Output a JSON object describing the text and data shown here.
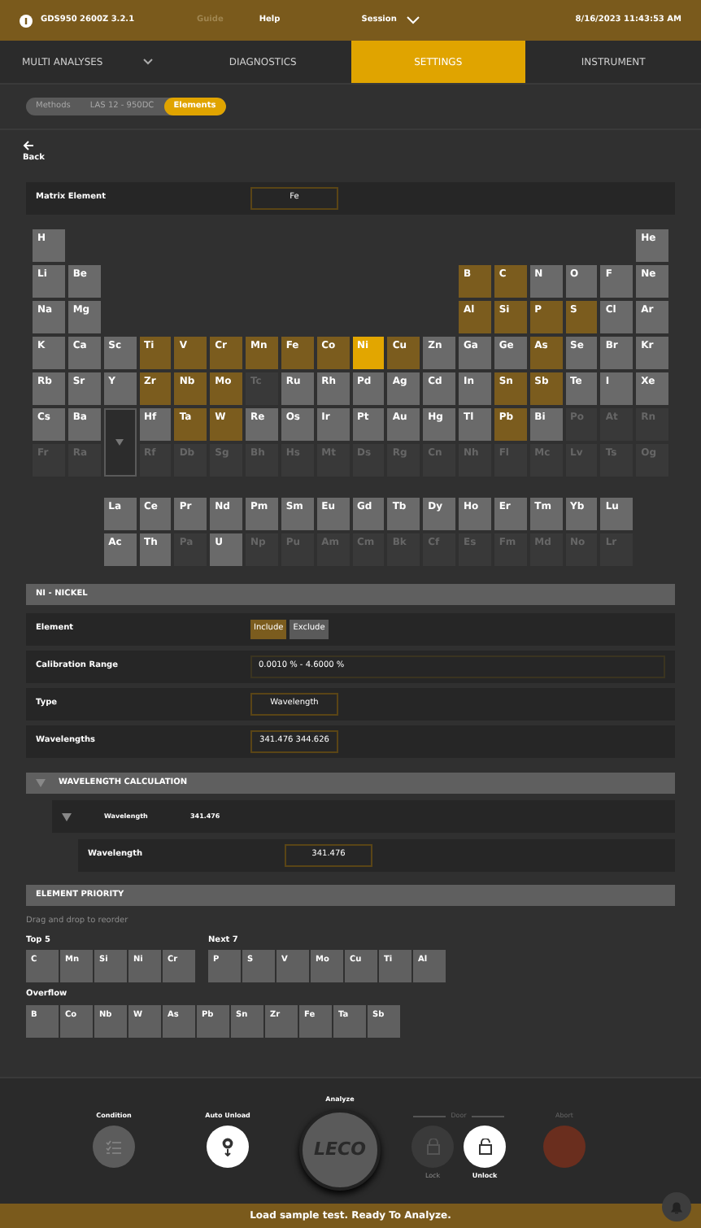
{
  "top_bar": {
    "title": "GDS950 2600Z 3.2.1",
    "links": [
      {
        "label": "Guide",
        "disabled": true
      },
      {
        "label": "Help",
        "disabled": false
      }
    ],
    "session": "Session",
    "datetime": "8/16/2023 11:43:53 AM"
  },
  "tabs": [
    {
      "label": "MULTI ANALYSES",
      "selected": false,
      "dropdown": true
    },
    {
      "label": "DIAGNOSTICS",
      "selected": false,
      "dropdown": false
    },
    {
      "label": "SETTINGS",
      "selected": true,
      "dropdown": false
    },
    {
      "label": "INSTRUMENT",
      "selected": false,
      "dropdown": false
    }
  ],
  "breadcrumb": [
    {
      "label": "Methods",
      "selected": false
    },
    {
      "label": "LAS 12 - 950DC",
      "selected": false
    },
    {
      "label": "Elements",
      "selected": true
    }
  ],
  "back": "Back",
  "matrix": {
    "label": "Matrix Element",
    "value": "Fe"
  },
  "periodic_table": {
    "rows": [
      [
        {
          "s": "H",
          "included": false,
          "selected": false,
          "available": true
        },
        null,
        null,
        null,
        null,
        null,
        null,
        null,
        null,
        null,
        null,
        null,
        null,
        null,
        null,
        null,
        null,
        {
          "s": "He",
          "included": false,
          "selected": false,
          "available": true
        }
      ],
      [
        {
          "s": "Li",
          "included": false,
          "selected": false,
          "available": true
        },
        {
          "s": "Be",
          "included": false,
          "selected": false,
          "available": true
        },
        null,
        null,
        null,
        null,
        null,
        null,
        null,
        null,
        null,
        null,
        {
          "s": "B",
          "included": true,
          "selected": false,
          "available": true
        },
        {
          "s": "C",
          "included": true,
          "selected": false,
          "available": true
        },
        {
          "s": "N",
          "included": false,
          "selected": false,
          "available": true
        },
        {
          "s": "O",
          "included": false,
          "selected": false,
          "available": true
        },
        {
          "s": "F",
          "included": false,
          "selected": false,
          "available": true
        },
        {
          "s": "Ne",
          "included": false,
          "selected": false,
          "available": true
        }
      ],
      [
        {
          "s": "Na",
          "included": false,
          "selected": false,
          "available": true
        },
        {
          "s": "Mg",
          "included": false,
          "selected": false,
          "available": true
        },
        null,
        null,
        null,
        null,
        null,
        null,
        null,
        null,
        null,
        null,
        {
          "s": "Al",
          "included": true,
          "selected": false,
          "available": true
        },
        {
          "s": "Si",
          "included": true,
          "selected": false,
          "available": true
        },
        {
          "s": "P",
          "included": true,
          "selected": false,
          "available": true
        },
        {
          "s": "S",
          "included": true,
          "selected": false,
          "available": true
        },
        {
          "s": "Cl",
          "included": false,
          "selected": false,
          "available": true
        },
        {
          "s": "Ar",
          "included": false,
          "selected": false,
          "available": true
        }
      ],
      [
        {
          "s": "K",
          "included": false,
          "selected": false,
          "available": true
        },
        {
          "s": "Ca",
          "included": false,
          "selected": false,
          "available": true
        },
        {
          "s": "Sc",
          "included": false,
          "selected": false,
          "available": true
        },
        {
          "s": "Ti",
          "included": true,
          "selected": false,
          "available": true
        },
        {
          "s": "V",
          "included": true,
          "selected": false,
          "available": true
        },
        {
          "s": "Cr",
          "included": true,
          "selected": false,
          "available": true
        },
        {
          "s": "Mn",
          "included": true,
          "selected": false,
          "available": true
        },
        {
          "s": "Fe",
          "included": true,
          "selected": false,
          "available": true
        },
        {
          "s": "Co",
          "included": true,
          "selected": false,
          "available": true
        },
        {
          "s": "Ni",
          "included": true,
          "selected": true,
          "available": true
        },
        {
          "s": "Cu",
          "included": true,
          "selected": false,
          "available": true
        },
        {
          "s": "Zn",
          "included": false,
          "selected": false,
          "available": true
        },
        {
          "s": "Ga",
          "included": false,
          "selected": false,
          "available": true
        },
        {
          "s": "Ge",
          "included": false,
          "selected": false,
          "available": true
        },
        {
          "s": "As",
          "included": true,
          "selected": false,
          "available": true
        },
        {
          "s": "Se",
          "included": false,
          "selected": false,
          "available": true
        },
        {
          "s": "Br",
          "included": false,
          "selected": false,
          "available": true
        },
        {
          "s": "Kr",
          "included": false,
          "selected": false,
          "available": true
        }
      ],
      [
        {
          "s": "Rb",
          "included": false,
          "selected": false,
          "available": true
        },
        {
          "s": "Sr",
          "included": false,
          "selected": false,
          "available": true
        },
        {
          "s": "Y",
          "included": false,
          "selected": false,
          "available": true
        },
        {
          "s": "Zr",
          "included": true,
          "selected": false,
          "available": true
        },
        {
          "s": "Nb",
          "included": true,
          "selected": false,
          "available": true
        },
        {
          "s": "Mo",
          "included": true,
          "selected": false,
          "available": true
        },
        {
          "s": "Tc",
          "included": false,
          "selected": false,
          "available": false
        },
        {
          "s": "Ru",
          "included": false,
          "selected": false,
          "available": true
        },
        {
          "s": "Rh",
          "included": false,
          "selected": false,
          "available": true
        },
        {
          "s": "Pd",
          "included": false,
          "selected": false,
          "available": true
        },
        {
          "s": "Ag",
          "included": false,
          "selected": false,
          "available": true
        },
        {
          "s": "Cd",
          "included": false,
          "selected": false,
          "available": true
        },
        {
          "s": "In",
          "included": false,
          "selected": false,
          "available": true
        },
        {
          "s": "Sn",
          "included": true,
          "selected": false,
          "available": true
        },
        {
          "s": "Sb",
          "included": true,
          "selected": false,
          "available": true
        },
        {
          "s": "Te",
          "included": false,
          "selected": false,
          "available": true
        },
        {
          "s": "I",
          "included": false,
          "selected": false,
          "available": true
        },
        {
          "s": "Xe",
          "included": false,
          "selected": false,
          "available": true
        }
      ],
      [
        {
          "s": "Cs",
          "included": false,
          "selected": false,
          "available": true
        },
        {
          "s": "Ba",
          "included": false,
          "selected": false,
          "available": true
        },
        null,
        {
          "s": "Hf",
          "included": false,
          "selected": false,
          "available": true
        },
        {
          "s": "Ta",
          "included": true,
          "selected": false,
          "available": true
        },
        {
          "s": "W",
          "included": true,
          "selected": false,
          "available": true
        },
        {
          "s": "Re",
          "included": false,
          "selected": false,
          "available": true
        },
        {
          "s": "Os",
          "included": false,
          "selected": false,
          "available": true
        },
        {
          "s": "Ir",
          "included": false,
          "selected": false,
          "available": true
        },
        {
          "s": "Pt",
          "included": false,
          "selected": false,
          "available": true
        },
        {
          "s": "Au",
          "included": false,
          "selected": false,
          "available": true
        },
        {
          "s": "Hg",
          "included": false,
          "selected": false,
          "available": true
        },
        {
          "s": "Tl",
          "included": false,
          "selected": false,
          "available": true
        },
        {
          "s": "Pb",
          "included": true,
          "selected": false,
          "available": true
        },
        {
          "s": "Bi",
          "included": false,
          "selected": false,
          "available": true
        },
        {
          "s": "Po",
          "included": false,
          "selected": false,
          "available": false
        },
        {
          "s": "At",
          "included": false,
          "selected": false,
          "available": false
        },
        {
          "s": "Rn",
          "included": false,
          "selected": false,
          "available": false
        }
      ],
      [
        {
          "s": "Fr",
          "included": false,
          "selected": false,
          "available": false
        },
        {
          "s": "Ra",
          "included": false,
          "selected": false,
          "available": false
        },
        null,
        {
          "s": "Rf",
          "included": false,
          "selected": false,
          "available": false
        },
        {
          "s": "Db",
          "included": false,
          "selected": false,
          "available": false
        },
        {
          "s": "Sg",
          "included": false,
          "selected": false,
          "available": false
        },
        {
          "s": "Bh",
          "included": false,
          "selected": false,
          "available": false
        },
        {
          "s": "Hs",
          "included": false,
          "selected": false,
          "available": false
        },
        {
          "s": "Mt",
          "included": false,
          "selected": false,
          "available": false
        },
        {
          "s": "Ds",
          "included": false,
          "selected": false,
          "available": false
        },
        {
          "s": "Rg",
          "included": false,
          "selected": false,
          "available": false
        },
        {
          "s": "Cn",
          "included": false,
          "selected": false,
          "available": false
        },
        {
          "s": "Nh",
          "included": false,
          "selected": false,
          "available": false
        },
        {
          "s": "Fl",
          "included": false,
          "selected": false,
          "available": false
        },
        {
          "s": "Mc",
          "included": false,
          "selected": false,
          "available": false
        },
        {
          "s": "Lv",
          "included": false,
          "selected": false,
          "available": false
        },
        {
          "s": "Ts",
          "included": false,
          "selected": false,
          "available": false
        },
        {
          "s": "Og",
          "included": false,
          "selected": false,
          "available": false
        }
      ]
    ],
    "f_block": [
      [
        {
          "s": "La",
          "included": false,
          "selected": false,
          "available": true
        },
        {
          "s": "Ce",
          "included": false,
          "selected": false,
          "available": true
        },
        {
          "s": "Pr",
          "included": false,
          "selected": false,
          "available": true
        },
        {
          "s": "Nd",
          "included": false,
          "selected": false,
          "available": true
        },
        {
          "s": "Pm",
          "included": false,
          "selected": false,
          "available": true
        },
        {
          "s": "Sm",
          "included": false,
          "selected": false,
          "available": true
        },
        {
          "s": "Eu",
          "included": false,
          "selected": false,
          "available": true
        },
        {
          "s": "Gd",
          "included": false,
          "selected": false,
          "available": true
        },
        {
          "s": "Tb",
          "included": false,
          "selected": false,
          "available": true
        },
        {
          "s": "Dy",
          "included": false,
          "selected": false,
          "available": true
        },
        {
          "s": "Ho",
          "included": false,
          "selected": false,
          "available": true
        },
        {
          "s": "Er",
          "included": false,
          "selected": false,
          "available": true
        },
        {
          "s": "Tm",
          "included": false,
          "selected": false,
          "available": true
        },
        {
          "s": "Yb",
          "included": false,
          "selected": false,
          "available": true
        },
        {
          "s": "Lu",
          "included": false,
          "selected": false,
          "available": true
        }
      ],
      [
        {
          "s": "Ac",
          "included": false,
          "selected": false,
          "available": true
        },
        {
          "s": "Th",
          "included": false,
          "selected": false,
          "available": true
        },
        {
          "s": "Pa",
          "included": false,
          "selected": false,
          "available": false
        },
        {
          "s": "U",
          "included": false,
          "selected": false,
          "available": true
        },
        {
          "s": "Np",
          "included": false,
          "selected": false,
          "available": false
        },
        {
          "s": "Pu",
          "included": false,
          "selected": false,
          "available": false
        },
        {
          "s": "Am",
          "included": false,
          "selected": false,
          "available": false
        },
        {
          "s": "Cm",
          "included": false,
          "selected": false,
          "available": false
        },
        {
          "s": "Bk",
          "included": false,
          "selected": false,
          "available": false
        },
        {
          "s": "Cf",
          "included": false,
          "selected": false,
          "available": false
        },
        {
          "s": "Es",
          "included": false,
          "selected": false,
          "available": false
        },
        {
          "s": "Fm",
          "included": false,
          "selected": false,
          "available": false
        },
        {
          "s": "Md",
          "included": false,
          "selected": false,
          "available": false
        },
        {
          "s": "No",
          "included": false,
          "selected": false,
          "available": false
        },
        {
          "s": "Lr",
          "included": false,
          "selected": false,
          "available": false
        }
      ]
    ]
  },
  "element_section": {
    "title": "NI - NICKEL",
    "rows": [
      {
        "kind": "toggle",
        "label": "Element",
        "options": [
          {
            "label": "Include",
            "selected": true
          },
          {
            "label": "Exclude",
            "selected": false
          }
        ]
      },
      {
        "kind": "wide",
        "label": "Calibration Range",
        "value": "0.0010 % - 4.6000 %"
      },
      {
        "kind": "field",
        "label": "Type",
        "value": "Wavelength"
      },
      {
        "kind": "field",
        "label": "Wavelengths",
        "value": "341.476 344.626"
      }
    ]
  },
  "wavelength_calculation": {
    "title": "WAVELENGTH CALCULATION",
    "expanded": true,
    "entries": [
      {
        "label": "Wavelength",
        "value": "341.476",
        "expanded": true,
        "children": [
          {
            "label": "Wavelength",
            "value": "341.476"
          }
        ]
      }
    ]
  },
  "priority": {
    "title": "ELEMENT PRIORITY",
    "hint": "Drag and drop to reorder",
    "rows": [
      [
        {
          "label": "Top 5",
          "items": [
            "C",
            "Mn",
            "Si",
            "Ni",
            "Cr"
          ]
        },
        {
          "label": "Next 7",
          "items": [
            "P",
            "S",
            "V",
            "Mo",
            "Cu",
            "Ti",
            "Al"
          ]
        }
      ],
      [
        {
          "label": "Overflow",
          "items": [
            "B",
            "Co",
            "Nb",
            "W",
            "As",
            "Pb",
            "Sn",
            "Zr",
            "Fe",
            "Ta",
            "Sb"
          ]
        }
      ]
    ]
  },
  "controls": {
    "condition": {
      "label": "Condition",
      "on": false
    },
    "auto_unload": {
      "label": "Auto Unload",
      "on": true
    },
    "analyze": {
      "label": "Analyze",
      "logo": "LECO"
    },
    "door": {
      "label": "Door",
      "buttons": [
        {
          "label": "Lock",
          "disabled": true
        },
        {
          "label": "Unlock",
          "disabled": false
        }
      ]
    },
    "abort": {
      "label": "Abort",
      "disabled": true
    }
  },
  "status": "Load sample test. Ready To Analyze."
}
